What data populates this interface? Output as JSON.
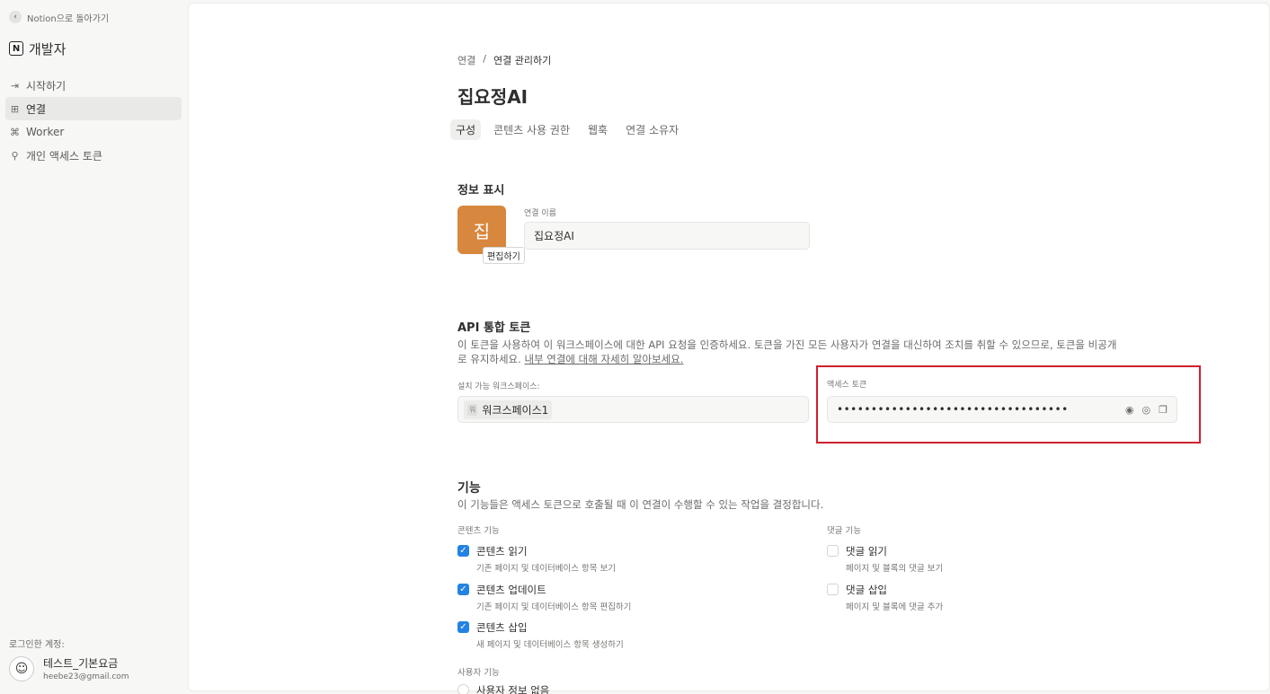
{
  "sidebar": {
    "back_label": "Notion으로 돌아가기",
    "brand_title": "개발자",
    "items": [
      {
        "label": "시작하기",
        "icon": "arrow-in-box-icon"
      },
      {
        "label": "연결",
        "icon": "grid-icon",
        "active": true
      },
      {
        "label": "Worker",
        "icon": "code-file-icon"
      },
      {
        "label": "개인 액세스 토큰",
        "icon": "person-key-icon"
      }
    ],
    "account_label": "로그인한 계정:",
    "account_name": "테스트_기본요금",
    "account_email": "heebe23@gmail.com"
  },
  "main": {
    "breadcrumb": {
      "parent": "연결",
      "separator": "/",
      "current": "연결 관리하기"
    },
    "title": "집요정AI",
    "tabs": [
      {
        "label": "구성",
        "active": true
      },
      {
        "label": "콘텐츠 사용 권한"
      },
      {
        "label": "웹훅"
      },
      {
        "label": "연결 소유자"
      }
    ],
    "info": {
      "section_title": "정보 표시",
      "icon_char": "집",
      "icon_color": "#d8873e",
      "edit_label": "편집하기",
      "name_label": "연결 이름",
      "name_value": "집요정AI"
    },
    "api": {
      "section_title": "API 통합 토큰",
      "desc_line1": "이 토큰을 사용하여 이 워크스페이스에 대한 API 요청을 인증하세요. 토큰을 가진 모든 사용자가 연결을 대신하여 조치를 취할 수 있으므로, 토큰을 비공개",
      "desc_line2_prefix": "로 유지하세요. ",
      "desc_link": "내부 연결에 대해 자세히 알아보세요.",
      "workspace_label": "설치 가능 워크스페이스:",
      "workspace_badge": "워",
      "workspace_name": "워크스페이스1",
      "token_label": "액세스 토큰",
      "token_masked": "••••••••••••••••••••••••••••••••••",
      "highlight_color": "#d0202e"
    },
    "capabilities": {
      "section_title": "기능",
      "desc": "이 기능들은 액세스 토큰으로 호출될 때 이 연결이 수행할 수 있는 작업을 결정합니다.",
      "content_label": "콘텐츠 기능",
      "comment_label": "댓글 기능",
      "content": [
        {
          "title": "콘텐츠 읽기",
          "desc": "기존 페이지 및 데이터베이스 항목 보기",
          "checked": true
        },
        {
          "title": "콘텐츠 업데이트",
          "desc": "기존 페이지 및 데이터베이스 항목 편집하기",
          "checked": true
        },
        {
          "title": "콘텐츠 삽입",
          "desc": "새 페이지 및 데이터베이스 항목 생성하기",
          "checked": true
        }
      ],
      "comment": [
        {
          "title": "댓글 읽기",
          "desc": "페이지 및 블록의 댓글 보기",
          "checked": false
        },
        {
          "title": "댓글 삽입",
          "desc": "페이지 및 블록에 댓글 추가",
          "checked": false
        }
      ],
      "user_label": "사용자 기능",
      "user_option": "사용자 정보 없음"
    }
  }
}
